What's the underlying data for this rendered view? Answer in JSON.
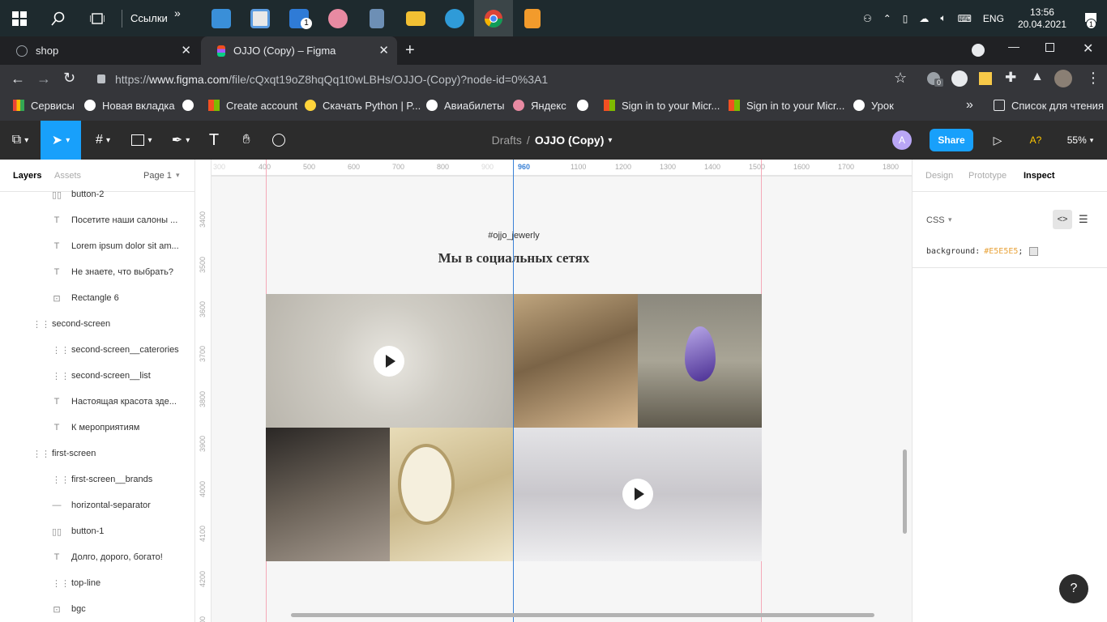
{
  "taskbar": {
    "links_label": "Ссылки",
    "chevrons": "»",
    "mail_badge": "1",
    "lang": "ENG",
    "time": "13:56",
    "date": "20.04.2021",
    "notif_badge": "1"
  },
  "tabs": [
    {
      "label": "shop"
    },
    {
      "label": "OJJO (Copy) – Figma"
    }
  ],
  "address": {
    "prefix": "https://",
    "host": "www.figma.com",
    "path": "/file/cQxqt19oZ8hqQq1t0wLBHs/OJJO-(Copy)?node-id=0%3A1",
    "ext_badge": "0"
  },
  "bookmarks": [
    {
      "label": "Сервисы"
    },
    {
      "label": "Новая вкладка"
    },
    {
      "label": "Create account"
    },
    {
      "label": "Скачать Python | P..."
    },
    {
      "label": "Авиабилеты"
    },
    {
      "label": "Яндекс"
    },
    {
      "label": "Sign in to your Micr..."
    },
    {
      "label": "Sign in to your Micr..."
    },
    {
      "label": "Урок"
    },
    {
      "label": "Список для чтения"
    }
  ],
  "bookmarks_more": "»",
  "figma": {
    "breadcrumb_root": "Drafts",
    "breadcrumb_sep": "/",
    "file_name": "OJJO (Copy)",
    "avatar": "A",
    "share": "Share",
    "font_warn": "A?",
    "zoom": "55%"
  },
  "left_panel": {
    "tab_layers": "Layers",
    "tab_assets": "Assets",
    "page": "Page 1",
    "layers": [
      {
        "name": "button-2",
        "glyph": "▯▯"
      },
      {
        "name": "Посетите наши салоны ...",
        "glyph": "T"
      },
      {
        "name": "Lorem ipsum dolor sit am...",
        "glyph": "T"
      },
      {
        "name": "Не знаете, что выбрать?",
        "glyph": "T"
      },
      {
        "name": "Rectangle 6",
        "glyph": "⊡"
      },
      {
        "name": "second-screen",
        "glyph": "⋮⋮"
      },
      {
        "name": "second-screen__caterories",
        "glyph": "⋮⋮"
      },
      {
        "name": "second-screen__list",
        "glyph": "⋮⋮"
      },
      {
        "name": "Настоящая красота зде...",
        "glyph": "T"
      },
      {
        "name": "К мероприятиям",
        "glyph": "T"
      },
      {
        "name": "first-screen",
        "glyph": "⋮⋮"
      },
      {
        "name": "first-screen__brands",
        "glyph": "⋮⋮"
      },
      {
        "name": "horizontal-separator",
        "glyph": "—"
      },
      {
        "name": "button-1",
        "glyph": "▯▯"
      },
      {
        "name": "Долго, дорого, богато!",
        "glyph": "T"
      },
      {
        "name": "top-line",
        "glyph": "⋮⋮"
      },
      {
        "name": "bgc",
        "glyph": "⊡"
      }
    ]
  },
  "ruler": {
    "x_ticks": [
      "300",
      "400",
      "500",
      "600",
      "700",
      "800",
      "900",
      "960",
      "1100",
      "1200",
      "1300",
      "1400",
      "1500",
      "1600",
      "1700",
      "1800"
    ],
    "y_ticks": [
      "3400",
      "3500",
      "3600",
      "3700",
      "3800",
      "3900",
      "4000",
      "4100",
      "4200",
      "300"
    ]
  },
  "canvas": {
    "hashtag": "#ojjo_jewerly",
    "heading": "Мы в социальных сетях"
  },
  "right_panel": {
    "tab_design": "Design",
    "tab_prototype": "Prototype",
    "tab_inspect": "Inspect",
    "lang": "CSS",
    "css_prop": "background:",
    "css_value": "#E5E5E5",
    "css_end": ";"
  },
  "help": "?"
}
